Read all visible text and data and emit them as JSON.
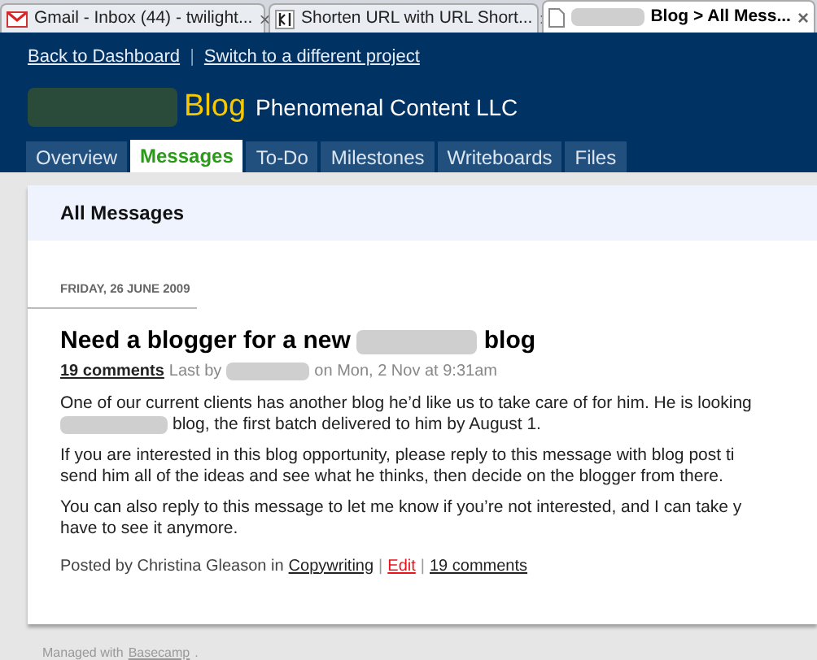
{
  "browser_tabs": [
    {
      "kind": "gmail",
      "title": [
        {
          "kind": "text",
          "text": "Gmail - Inbox (44) - twilight..."
        }
      ],
      "selected": false
    },
    {
      "kind": "kl",
      "title": [
        {
          "kind": "text",
          "text": "Shorten URL with URL Short..."
        }
      ],
      "selected": false
    },
    {
      "kind": "page",
      "title": [
        {
          "kind": "redacted"
        },
        {
          "kind": "text",
          "text": "Blog > All Mess..."
        }
      ],
      "selected": true
    }
  ],
  "close_glyph": "×",
  "header": {
    "links": [
      "Back to Dashboard",
      "Switch to a different project"
    ],
    "separator": "|",
    "project_redacted": true,
    "project": "Blog",
    "company": "Phenomenal Content LLC"
  },
  "nav_tabs": [
    {
      "label": "Overview",
      "selected": false
    },
    {
      "label": "Messages",
      "selected": true
    },
    {
      "label": "To-Do",
      "selected": false
    },
    {
      "label": "Milestones",
      "selected": false
    },
    {
      "label": "Writeboards",
      "selected": false
    },
    {
      "label": "Files",
      "selected": false
    }
  ],
  "panel_title": "All Messages",
  "date": "FRIDAY, 26 JUNE 2009",
  "message": {
    "title": [
      {
        "kind": "text",
        "text": "Need a blogger for a new"
      },
      {
        "kind": "redacted"
      },
      {
        "kind": "text",
        "text": "blog"
      }
    ],
    "meta": [
      {
        "kind": "link",
        "text": "19 comments"
      },
      {
        "kind": "text",
        "text": "Last by"
      },
      {
        "kind": "redacted"
      },
      {
        "kind": "text",
        "text": "on Mon, 2 Nov at 9:31am"
      }
    ],
    "paragraphs": [
      [
        [
          {
            "kind": "text",
            "text": "One of our current clients has another blog he’d like us to take care of for him. He is looking"
          }
        ],
        [
          {
            "kind": "redacted"
          },
          {
            "kind": "text",
            "text": "blog, the first batch delivered to him by August 1."
          }
        ]
      ],
      [
        [
          {
            "kind": "text",
            "text": "If you are interested in this blog opportunity, please reply to this message with blog post ti"
          }
        ],
        [
          {
            "kind": "text",
            "text": "send him all of the ideas and see what he thinks, then decide on the blogger from there."
          }
        ]
      ],
      [
        [
          {
            "kind": "text",
            "text": "You can also reply to this message to let me know if you’re not interested, and I can take y"
          }
        ],
        [
          {
            "kind": "text",
            "text": "have to see it anymore."
          }
        ]
      ]
    ],
    "footer": [
      {
        "kind": "text",
        "text": "Posted by Christina Gleason in"
      },
      {
        "kind": "link",
        "text": "Copywriting"
      },
      {
        "kind": "sep",
        "text": "|"
      },
      {
        "kind": "edit",
        "text": "Edit"
      },
      {
        "kind": "sep",
        "text": "|"
      },
      {
        "kind": "link",
        "text": "19 comments"
      }
    ]
  },
  "page_footer": [
    {
      "kind": "text",
      "text": "Managed with"
    },
    {
      "kind": "link",
      "text": "Basecamp"
    },
    {
      "kind": "text",
      "text": "."
    }
  ]
}
